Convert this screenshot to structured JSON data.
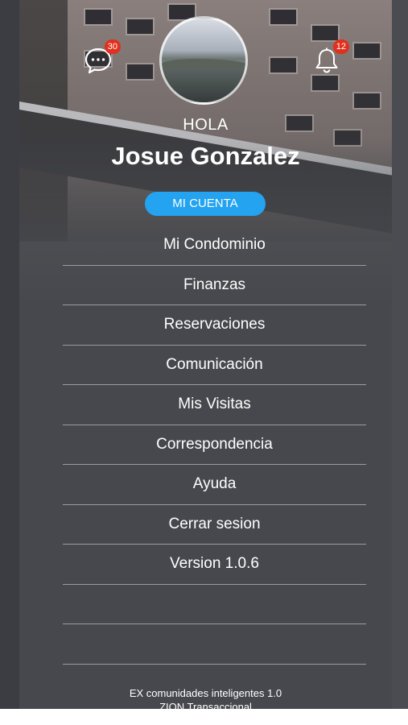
{
  "header": {
    "chat_badge": "30",
    "notifications_badge": "12",
    "greeting": "HOLA",
    "user_name": "Josue Gonzalez",
    "account_button": "MI CUENTA"
  },
  "menu": {
    "items": [
      "Mi Condominio",
      "Finanzas",
      "Reservaciones",
      "Comunicación",
      "Mis Visitas",
      "Correspondencia",
      "Ayuda",
      "Cerrar sesion",
      "Version 1.0.6"
    ]
  },
  "footer": {
    "line1": "EX comunidades inteligentes 1.0",
    "line2": "ZION Transaccional"
  },
  "icons": {
    "chat": "chat-bubble-icon",
    "notifications": "bell-icon"
  },
  "colors": {
    "panel": "#46484d",
    "accent": "#23a3f0",
    "badge": "#e0301e"
  }
}
